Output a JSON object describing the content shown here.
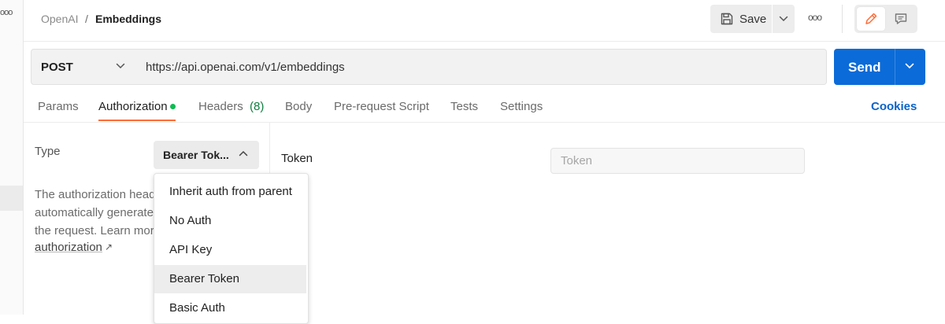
{
  "colors": {
    "accent": "#ff6c37",
    "send_button": "#0b6bd8",
    "cookies_link": "#0b63c9",
    "status_dot": "#0cbb52"
  },
  "header": {
    "breadcrumb_parent": "OpenAI",
    "breadcrumb_separator": "/",
    "breadcrumb_current": "Embeddings",
    "save_label": "Save",
    "more_icon": "more-horizontal-icon"
  },
  "request": {
    "method": "POST",
    "url": "https://api.openai.com/v1/embeddings",
    "send_label": "Send"
  },
  "tabs": [
    {
      "label": "Params"
    },
    {
      "label": "Authorization",
      "active": true
    },
    {
      "label": "Headers",
      "count": "(8)"
    },
    {
      "label": "Body"
    },
    {
      "label": "Pre-request Script"
    },
    {
      "label": "Tests"
    },
    {
      "label": "Settings"
    }
  ],
  "cookies_label": "Cookies",
  "auth": {
    "type_label": "Type",
    "type_value": "Bearer Tok...",
    "description_lines": [
      "The authorization head",
      "automatically generate",
      "the request. Learn more"
    ],
    "learn_link": "authorization",
    "options": [
      {
        "label": "Inherit auth from parent"
      },
      {
        "label": "No Auth"
      },
      {
        "label": "API Key"
      },
      {
        "label": "Bearer Token",
        "selected": true
      },
      {
        "label": "Basic Auth"
      }
    ],
    "token_label": "Token",
    "token_placeholder": "Token",
    "token_value": ""
  }
}
